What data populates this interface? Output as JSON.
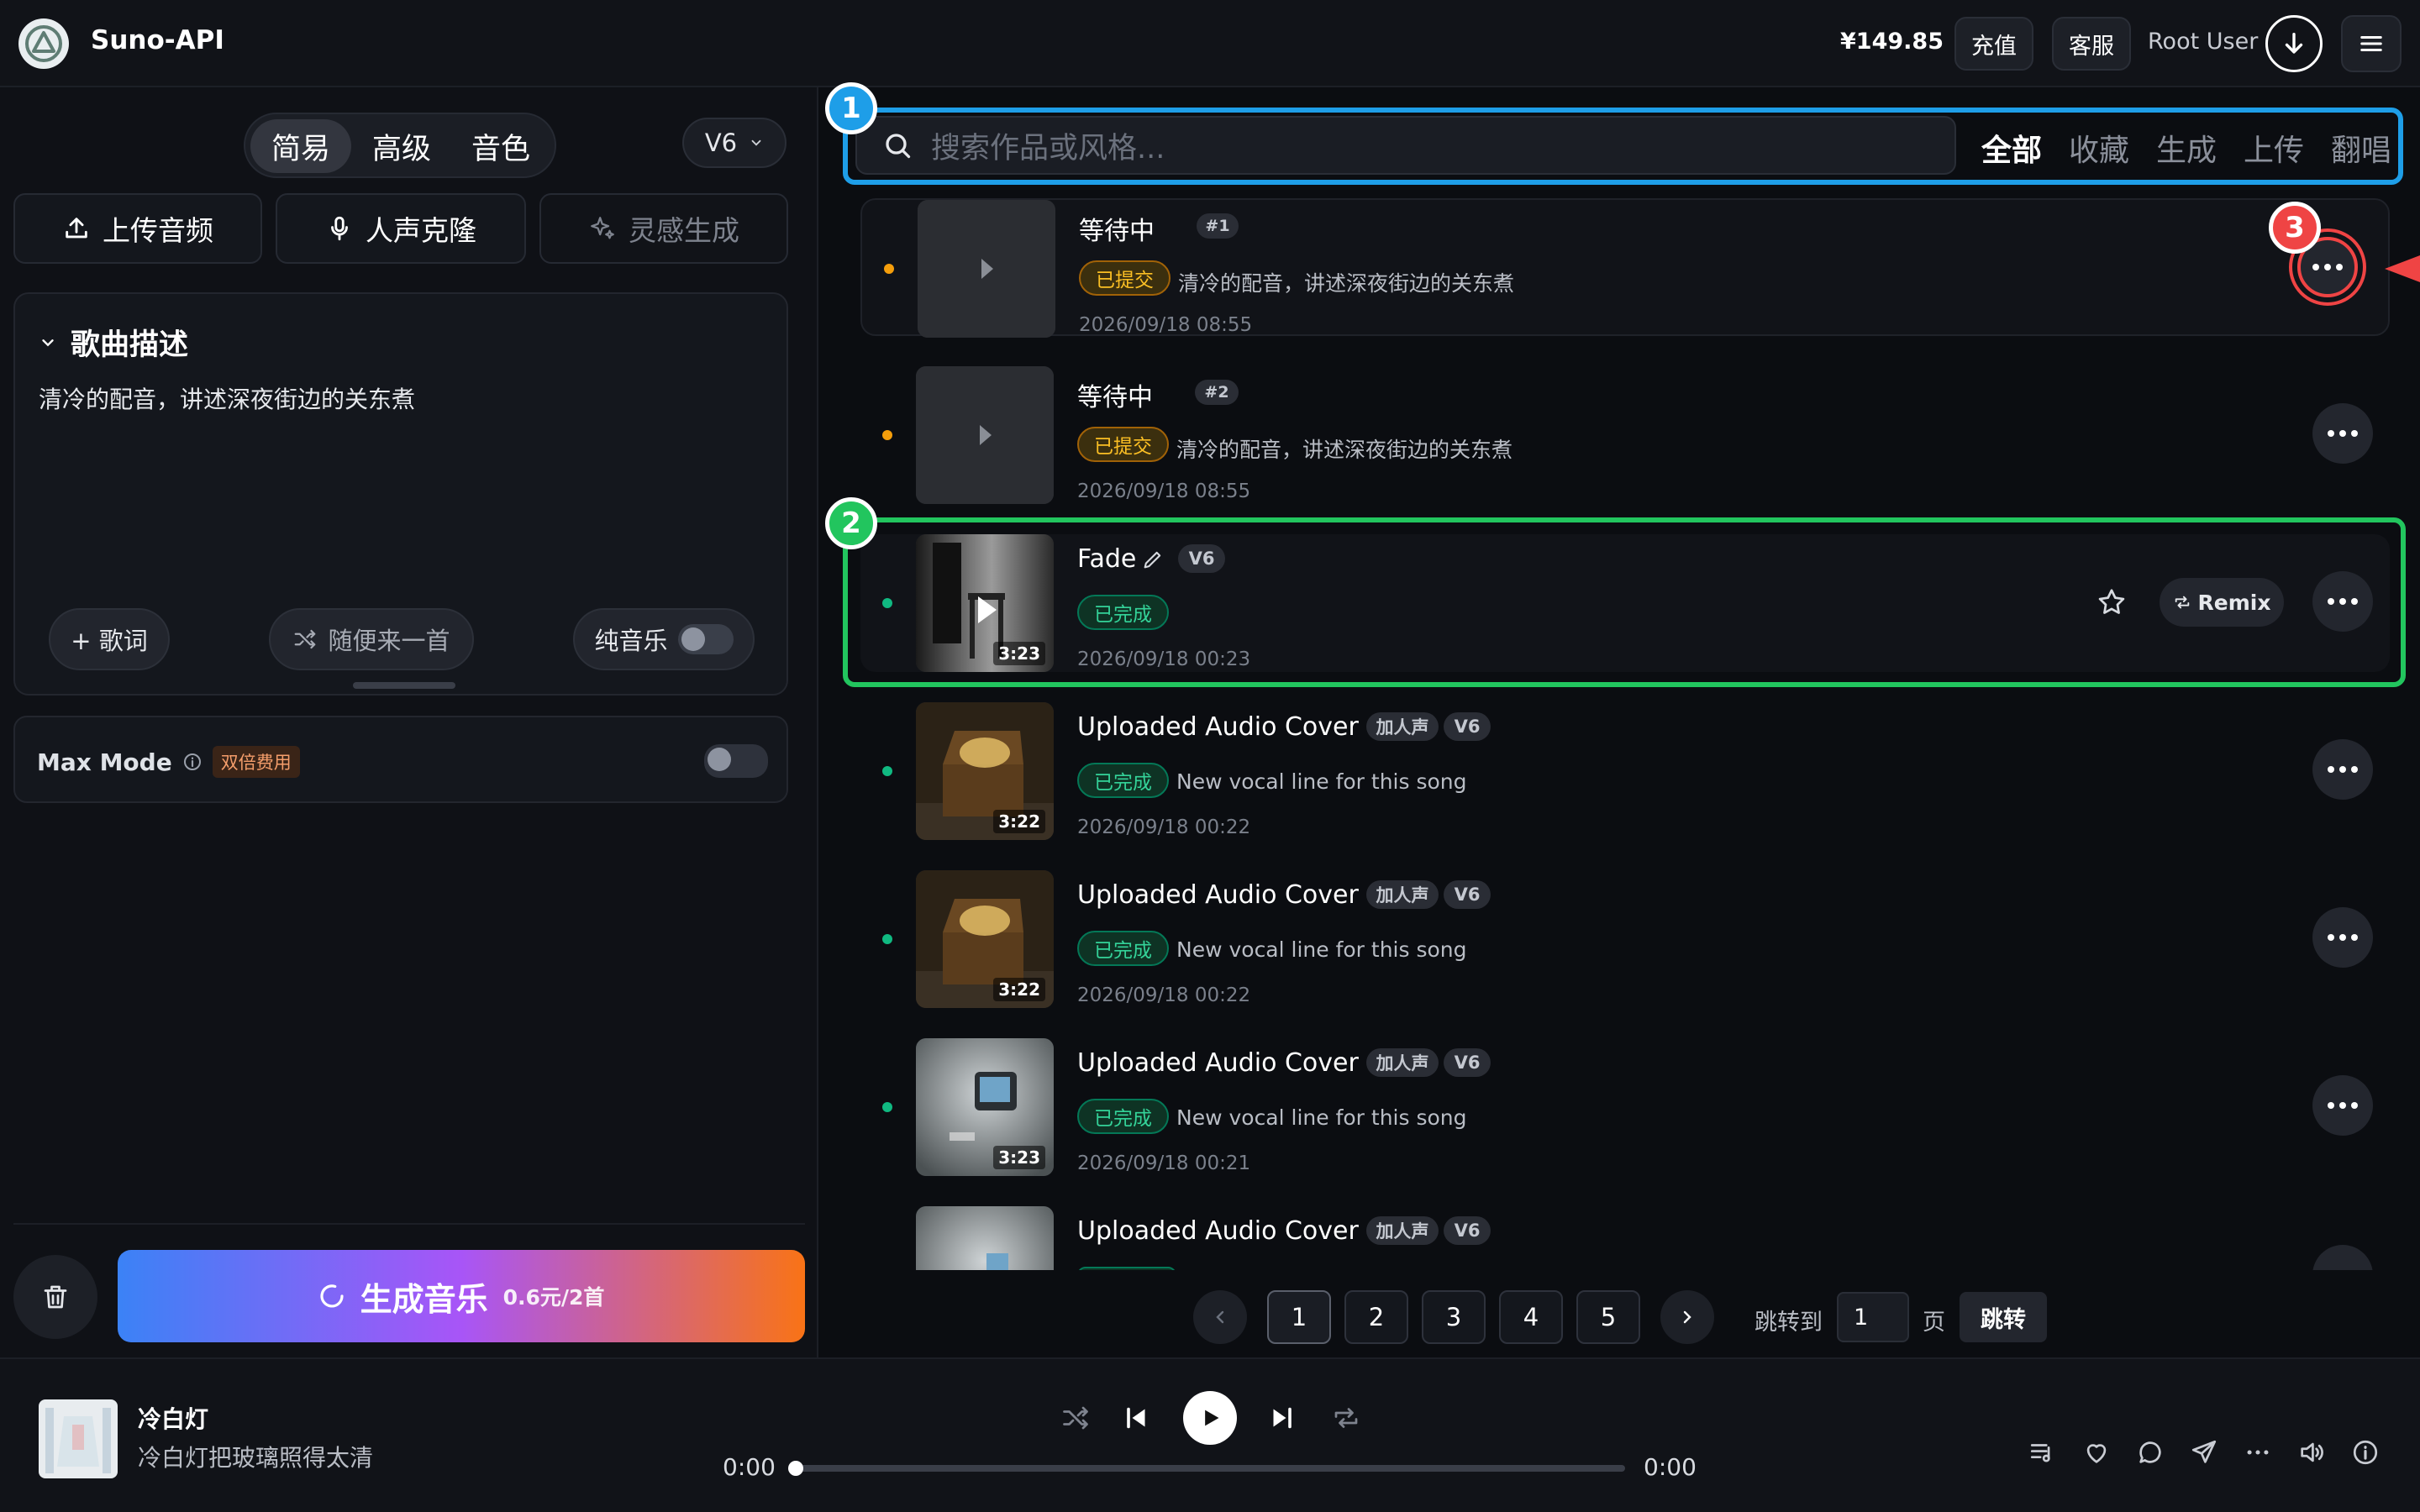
{
  "header": {
    "brand": "Suno-API",
    "balance": "¥149.85",
    "recharge": "充值",
    "support": "客服",
    "user": "Root User"
  },
  "left": {
    "modes": [
      "简易",
      "高级",
      "音色"
    ],
    "version": "V6",
    "actions": {
      "upload": "上传音频",
      "clone": "人声克隆",
      "inspire": "灵感生成"
    },
    "desc": {
      "title": "歌曲描述",
      "text": "清冷的配音，讲述深夜街边的关东煮"
    },
    "pills": {
      "lyrics": "+ 歌词",
      "random": "随便来一首",
      "instrumental": "纯音乐"
    },
    "maxmode": {
      "label": "Max Mode",
      "badge": "双倍费用"
    },
    "generate": {
      "label": "生成音乐",
      "price": "0.6元/2首"
    }
  },
  "right": {
    "search_placeholder": "搜索作品或风格...",
    "filters": [
      "全部",
      "收藏",
      "生成",
      "上传",
      "翻唱"
    ],
    "annotations": [
      "1",
      "2",
      "3"
    ],
    "remix": "Remix",
    "songs": [
      {
        "title": "等待中",
        "tags": [
          "#1"
        ],
        "status": "已提交",
        "desc": "清冷的配音，讲述深夜街边的关东煮",
        "time": "2026/09/18 08:55",
        "duration": ""
      },
      {
        "title": "等待中",
        "tags": [
          "#2"
        ],
        "status": "已提交",
        "desc": "清冷的配音，讲述深夜街边的关东煮",
        "time": "2026/09/18 08:55",
        "duration": ""
      },
      {
        "title": "Fade",
        "tags": [
          "V6"
        ],
        "status": "已完成",
        "desc": "",
        "time": "2026/09/18 00:23",
        "duration": "3:23"
      },
      {
        "title": "Uploaded Audio Cover",
        "tags": [
          "加人声",
          "V6"
        ],
        "status": "已完成",
        "desc": "New vocal line for this song",
        "time": "2026/09/18 00:22",
        "duration": "3:22"
      },
      {
        "title": "Uploaded Audio Cover",
        "tags": [
          "加人声",
          "V6"
        ],
        "status": "已完成",
        "desc": "New vocal line for this song",
        "time": "2026/09/18 00:22",
        "duration": "3:22"
      },
      {
        "title": "Uploaded Audio Cover",
        "tags": [
          "加人声",
          "V6"
        ],
        "status": "已完成",
        "desc": "New vocal line for this song",
        "time": "2026/09/18 00:21",
        "duration": "3:23"
      },
      {
        "title": "Uploaded Audio Cover",
        "tags": [
          "加人声",
          "V6"
        ],
        "status": "",
        "desc": "",
        "time": "",
        "duration": ""
      }
    ],
    "pagination": {
      "pages": [
        "1",
        "2",
        "3",
        "4",
        "5"
      ],
      "jump_label": "跳转到",
      "jump_value": "1",
      "page_unit": "页",
      "jump_button": "跳转"
    }
  },
  "player": {
    "title": "冷白灯",
    "subtitle": "冷白灯把玻璃照得太清",
    "current": "0:00",
    "total": "0:00",
    "progress": 0
  },
  "colors": {
    "accent_blue": "#1e9ee8",
    "accent_green": "#22c55e",
    "accent_red": "#ef4444"
  }
}
